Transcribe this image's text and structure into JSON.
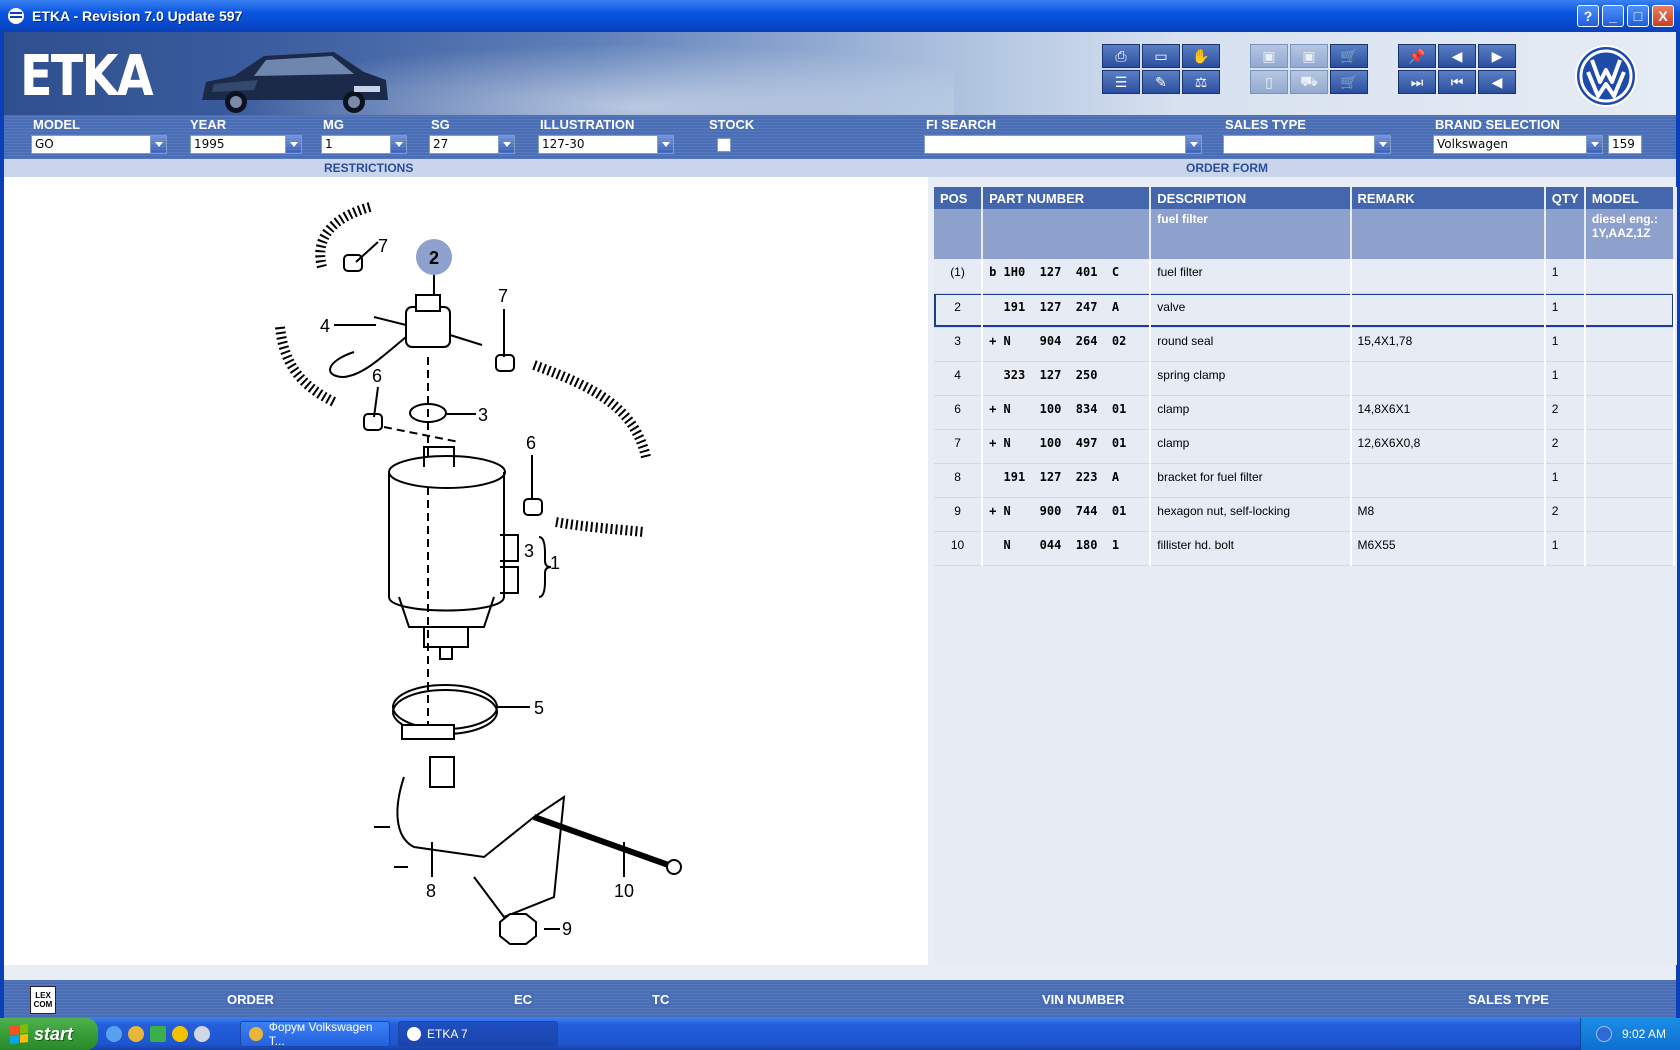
{
  "window": {
    "title": "ETKA - Revision 7.0 Update 597",
    "buttons": {
      "help": "?",
      "minimize": "_",
      "maximize": "□",
      "close": "X"
    }
  },
  "banner": {
    "logo": "ETKA"
  },
  "selectors": {
    "model": {
      "label": "MODEL",
      "value": "GO"
    },
    "year": {
      "label": "YEAR",
      "value": "1995"
    },
    "mg": {
      "label": "MG",
      "value": "1"
    },
    "sg": {
      "label": "SG",
      "value": "27"
    },
    "illustration": {
      "label": "ILLUSTRATION",
      "value": "127-30"
    },
    "stock": {
      "label": "STOCK"
    },
    "fi_search": {
      "label": "FI SEARCH",
      "value": ""
    },
    "sales_type": {
      "label": "SALES TYPE",
      "value": ""
    },
    "brand": {
      "label": "BRAND SELECTION",
      "value": "Volkswagen",
      "count": "159"
    }
  },
  "sections": {
    "restrictions": "RESTRICTIONS",
    "order_form": "ORDER FORM"
  },
  "illustration_labels": {
    "callout": "2",
    "n1": "1",
    "n3a": "3",
    "n3b": "3",
    "n4": "4",
    "n5": "5",
    "n6a": "6",
    "n6b": "6",
    "n7a": "7",
    "n7b": "7",
    "n8": "8",
    "n9": "9",
    "n10": "10"
  },
  "table": {
    "headers": {
      "pos": "POS",
      "part": "PART NUMBER",
      "desc": "DESCRIPTION",
      "remark": "REMARK",
      "qty": "QTY",
      "model": "MODEL"
    },
    "group": {
      "desc": "fuel filter",
      "model": "diesel eng.:\n1Y,AAZ,1Z"
    },
    "rows": [
      {
        "pos": "(1)",
        "part": "b 1H0  127  401  C",
        "desc": "fuel filter",
        "remark": "",
        "qty": "1"
      },
      {
        "pos": "2",
        "part": "  191  127  247  A",
        "desc": "valve",
        "remark": "",
        "qty": "1"
      },
      {
        "pos": "3",
        "part": "+ N    904  264  02",
        "desc": "round seal",
        "remark": "15,4X1,78",
        "qty": "1"
      },
      {
        "pos": "4",
        "part": "  323  127  250",
        "desc": "spring clamp",
        "remark": "",
        "qty": "1"
      },
      {
        "pos": "6",
        "part": "+ N    100  834  01",
        "desc": "clamp",
        "remark": "14,8X6X1",
        "qty": "2"
      },
      {
        "pos": "7",
        "part": "+ N    100  497  01",
        "desc": "clamp",
        "remark": "12,6X6X0,8",
        "qty": "2"
      },
      {
        "pos": "8",
        "part": "  191  127  223  A",
        "desc": "bracket for fuel filter",
        "remark": "",
        "qty": "1"
      },
      {
        "pos": "9",
        "part": "+ N    900  744  01",
        "desc": "hexagon nut, self-locking",
        "remark": "M8",
        "qty": "2"
      },
      {
        "pos": "10",
        "part": "  N    044  180  1",
        "desc": "fillister hd. bolt",
        "remark": "M6X55",
        "qty": "1"
      }
    ]
  },
  "status": {
    "lexcom": "LEX\nCOM",
    "order": "ORDER",
    "ec": "EC",
    "tc": "TC",
    "vin": "VIN NUMBER",
    "sales_type": "SALES TYPE"
  },
  "taskbar": {
    "start": "start",
    "item1": "Форум Volkswagen T...",
    "item2": "ETKA 7",
    "clock": "9:02 AM"
  },
  "colors": {
    "accent": "#4466ad",
    "selected_border": "#1e3c8c",
    "callout": "#8ea0cc"
  }
}
